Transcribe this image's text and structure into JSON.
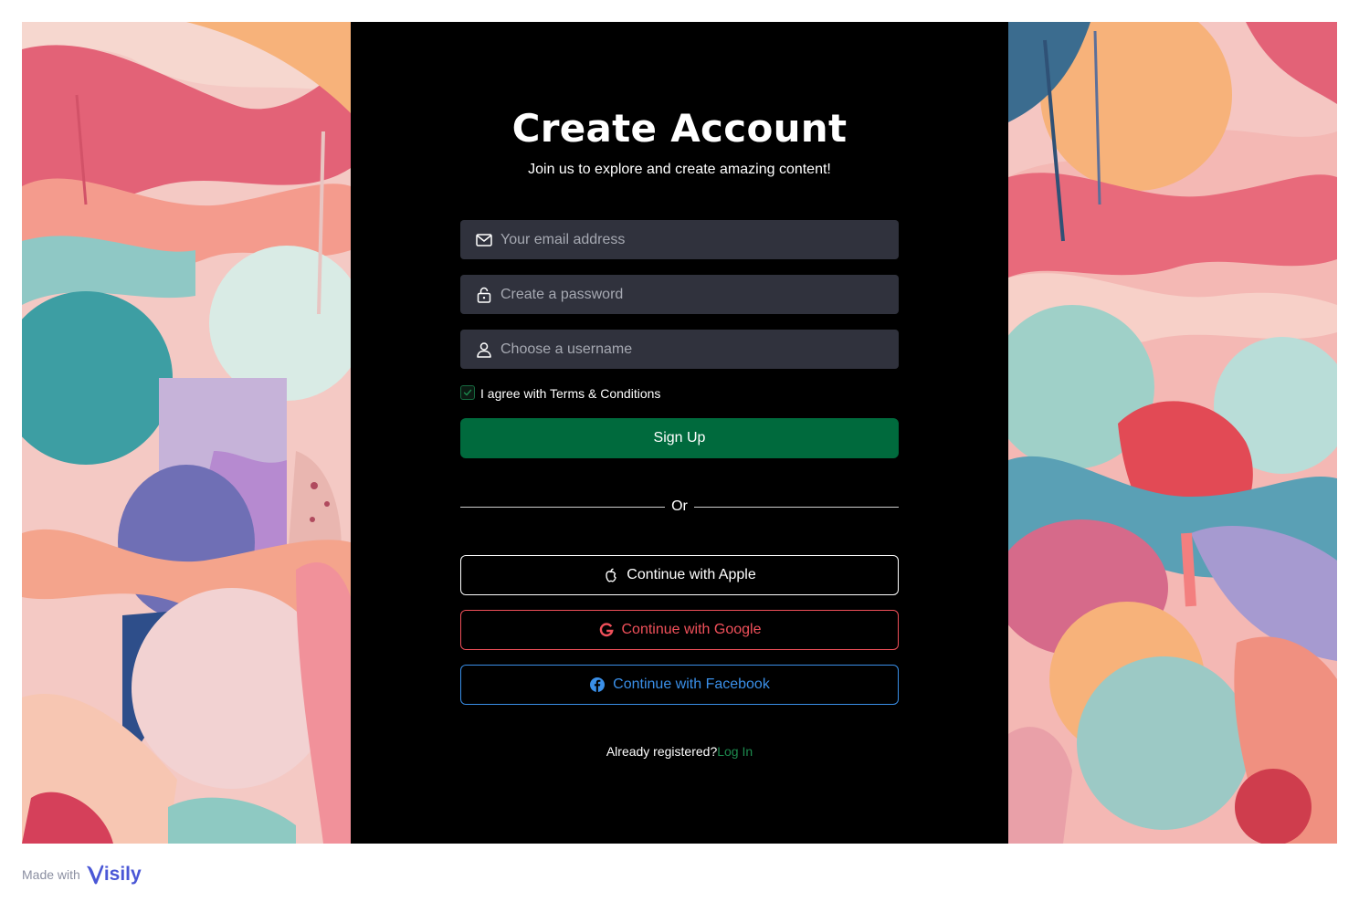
{
  "signup": {
    "title": "Create Account",
    "subtitle": "Join us to explore and create amazing content!",
    "email": {
      "placeholder": "Your email address",
      "icon": "mail-icon"
    },
    "password": {
      "placeholder": "Create a password",
      "icon": "lock-icon"
    },
    "username": {
      "placeholder": "Choose a username",
      "icon": "user-icon"
    },
    "agree_label": "I agree with Terms & Conditions",
    "agree_checked": true,
    "submit_label": "Sign Up",
    "divider_label": "Or",
    "apple_label": "Continue with Apple",
    "google_label": "Continue with Google",
    "facebook_label": "Continue with Facebook",
    "already_text": "Already registered?",
    "login_label": "Log In"
  },
  "footer": {
    "made_with": "Made with",
    "brand": "isily"
  },
  "colors": {
    "panel": "#000000",
    "input": "#30323d",
    "primary": "#006a3d",
    "link": "#1d8a4e",
    "google": "#f0505a",
    "facebook": "#3a8fe8",
    "brand": "#4a57d6"
  }
}
